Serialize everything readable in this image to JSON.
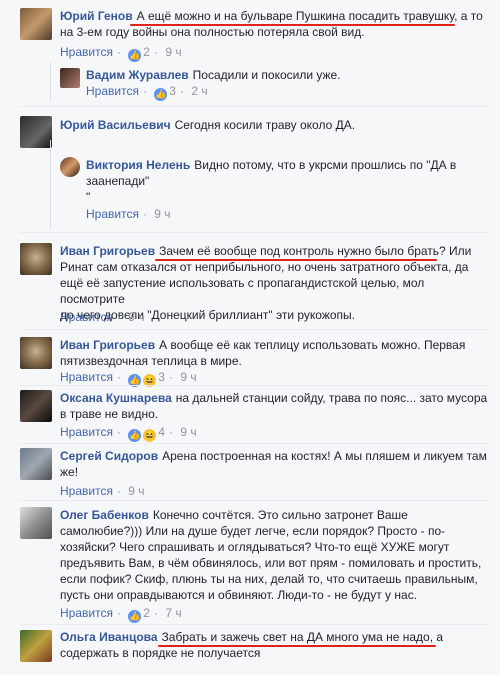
{
  "comments": [
    {
      "name": "Юрий Генов",
      "lines": [
        "А ещё можно и на бульваре Пушкина посадить травушку, а то",
        "на 3-ем году войны она полностью потеряла свой вид."
      ],
      "like": "Нравится",
      "reactions": "2",
      "time": "9 ч",
      "react_type": "like"
    },
    {
      "name": "Вадим Журавлев",
      "lines": [
        "Посадили и покосили уже."
      ],
      "like": "Нравится",
      "reactions": "3",
      "time": "2 ч",
      "react_type": "like"
    },
    {
      "name": "Юрий Васильевич",
      "lines": [
        "Сегодня косили траву около ДА."
      ],
      "like": "",
      "reactions": "",
      "time": ""
    },
    {
      "name": "Виктория Нелень",
      "lines": [
        "Видно потому, что в укрсми прошлись по \"ДА в",
        "заанепади\"",
        "\""
      ],
      "like": "Нравится",
      "reactions": "",
      "time": "9 ч"
    },
    {
      "name": "Иван Григорьев",
      "lines": [
        "Зачем её вообще под контроль нужно было брать? Или",
        "Ринат сам отказался от неприбыльного, но очень затратного объекта, да",
        "ещё её запустение использовать с пропагандистской целью, мол посмотрите",
        "до чего довели \"Донецкий бриллиант\" эти рукожопы."
      ],
      "like": "Нравится",
      "reactions": "",
      "time": "9 ч"
    },
    {
      "name": "Иван Григорьев",
      "lines": [
        "А вообще её как теплицу использовать можно. Первая",
        "пятизвездочная теплица в мире."
      ],
      "like": "Нравится",
      "reactions": "3",
      "time": "9 ч",
      "react_type": "like-haha"
    },
    {
      "name": "Оксана Кушнарева",
      "lines": [
        "на дальней станции сойду, трава по пояс... зато мусора",
        "в траве не видно."
      ],
      "like": "Нравится",
      "reactions": "4",
      "time": "9 ч",
      "react_type": "like-haha"
    },
    {
      "name": "Сергей Сидоров",
      "lines": [
        "Арена построенная на костях! А мы пляшем и ликуем там",
        "же!"
      ],
      "like": "Нравится",
      "reactions": "",
      "time": "9 ч"
    },
    {
      "name": "Олег Бабенков",
      "lines": [
        "Конечно сочтётся. Это сильно затронет Ваше",
        "самолюбие?))) Или на душе будет легче, если порядок? Просто - по-",
        "хозяйски? Чего спрашивать и оглядываться? Что-то ещё ХУЖЕ могут",
        "предъявить Вам, в чём обвинялось, или вот прям - помиловать и простить,",
        "если пофик? Скиф, плюнь ты на них, делай то, что считаешь правильным,",
        "пусть они оправдываются и обвиняют. Люди-то - не будут у нас."
      ],
      "like": "Нравится",
      "reactions": "2",
      "time": "7 ч",
      "react_type": "like"
    },
    {
      "name": "Ольга Иванцова",
      "lines": [
        "Забрать и зажечь свет на ДА много ума не надо, а",
        "содержать в порядке не получается"
      ],
      "like": "",
      "reactions": "",
      "time": ""
    }
  ]
}
